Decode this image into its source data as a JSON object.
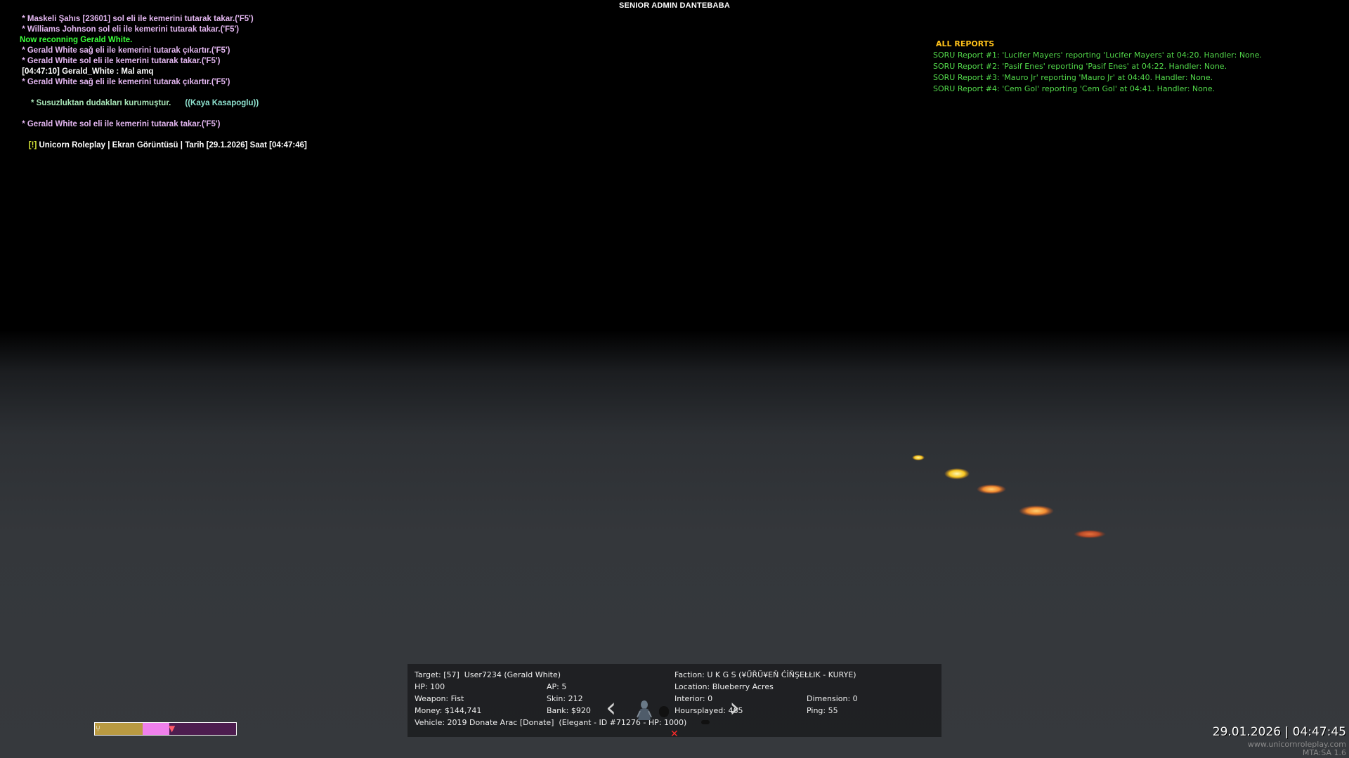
{
  "hud": {
    "title": "SENIOR ADMIN DANTEBABA"
  },
  "chat": {
    "lines": [
      {
        "text": " * Maskeli Şahıs [23601] sol eli ile kemerini tutarak takar.('F5')",
        "color": "#e3b6f0"
      },
      {
        "text": " * Williams Johnson sol eli ile kemerini tutarak takar.('F5')",
        "color": "#e3b6f0"
      },
      {
        "text": "Now reconning Gerald White.",
        "color": "#3bff3b"
      },
      {
        "text": " * Gerald White sağ eli ile kemerini tutarak çıkartır.('F5')",
        "color": "#e3b6f0"
      },
      {
        "text": " * Gerald White sol eli ile kemerini tutarak takar.('F5')",
        "color": "#e3b6f0"
      },
      {
        "text": " [04:47:10] Gerald_White : Mal amq",
        "color": "#ffffff"
      },
      {
        "text": " * Gerald White sağ eli ile kemerini tutarak çıkartır.('F5')",
        "color": "#e3b6f0"
      },
      {
        "text": " * Susuzluktan dudakları kurumuştur.",
        "color": "#a8e6b8",
        "extra": "((Kaya Kasapoglu))"
      },
      {
        "text": " * Gerald White sol eli ile kemerini tutarak takar.('F5')",
        "color": "#e3b6f0"
      }
    ],
    "last_prefix": "[!]",
    "last_text": " Unicorn Roleplay | Ekran Görüntüsü | Tarih [29.1.2026] Saat [04:47:46]"
  },
  "reports": {
    "title": "ALL REPORTS",
    "items": [
      "SORU Report #1: 'Lucifer Mayers' reporting 'Lucifer Mayers' at 04:20. Handler: None.",
      "SORU Report #2: 'Pasif Enes' reporting 'Pasif Enes' at 04:22. Handler: None.",
      "SORU Report #3: 'Mauro Jr' reporting 'Mauro Jr' at 04:40. Handler: None.",
      "SORU Report #4: 'Cem Gol' reporting 'Cem Gol' at 04:41. Handler: None."
    ]
  },
  "target": {
    "target": "Target: [57]  User7234 (Gerald White)",
    "hp": "HP: 100",
    "ap": "AP: 5",
    "weapon": "Weapon: Fist",
    "skin": "Skin: 212",
    "money": "Money: $144,741",
    "bank": "Bank: $920",
    "vehicle": "Vehicle: 2019 Donate Arac [Donate]  (Elegant - ID #71276 - HP: 1000)",
    "faction": "Faction: U K G S (¥ŰŘŬ¥EŇ ĆİŇŞEŁŁIK - KURYE)",
    "location": "Location: Blueberry Acres",
    "interior": "Interior: 0",
    "dimension": "Dimension: 0",
    "hoursplayed": "Hoursplayed: 465",
    "ping": "Ping: 55",
    "prev_arrow": "‹",
    "next_arrow": "›",
    "close_glyph": "✕"
  },
  "status": {
    "gold_fraction": 0.34,
    "pink_fraction": 0.19
  },
  "footer": {
    "clock": "29.01.2026 | 04:47:45",
    "website": "www.unicornroleplay.com",
    "version": "MTA:SA 1.6"
  },
  "colors": {
    "chat_pink": "#e3b6f0",
    "chat_green": "#3bff3b",
    "report_green": "#52d84a",
    "report_title": "#ffc21a",
    "prefix_yellow": "#d7e638"
  }
}
